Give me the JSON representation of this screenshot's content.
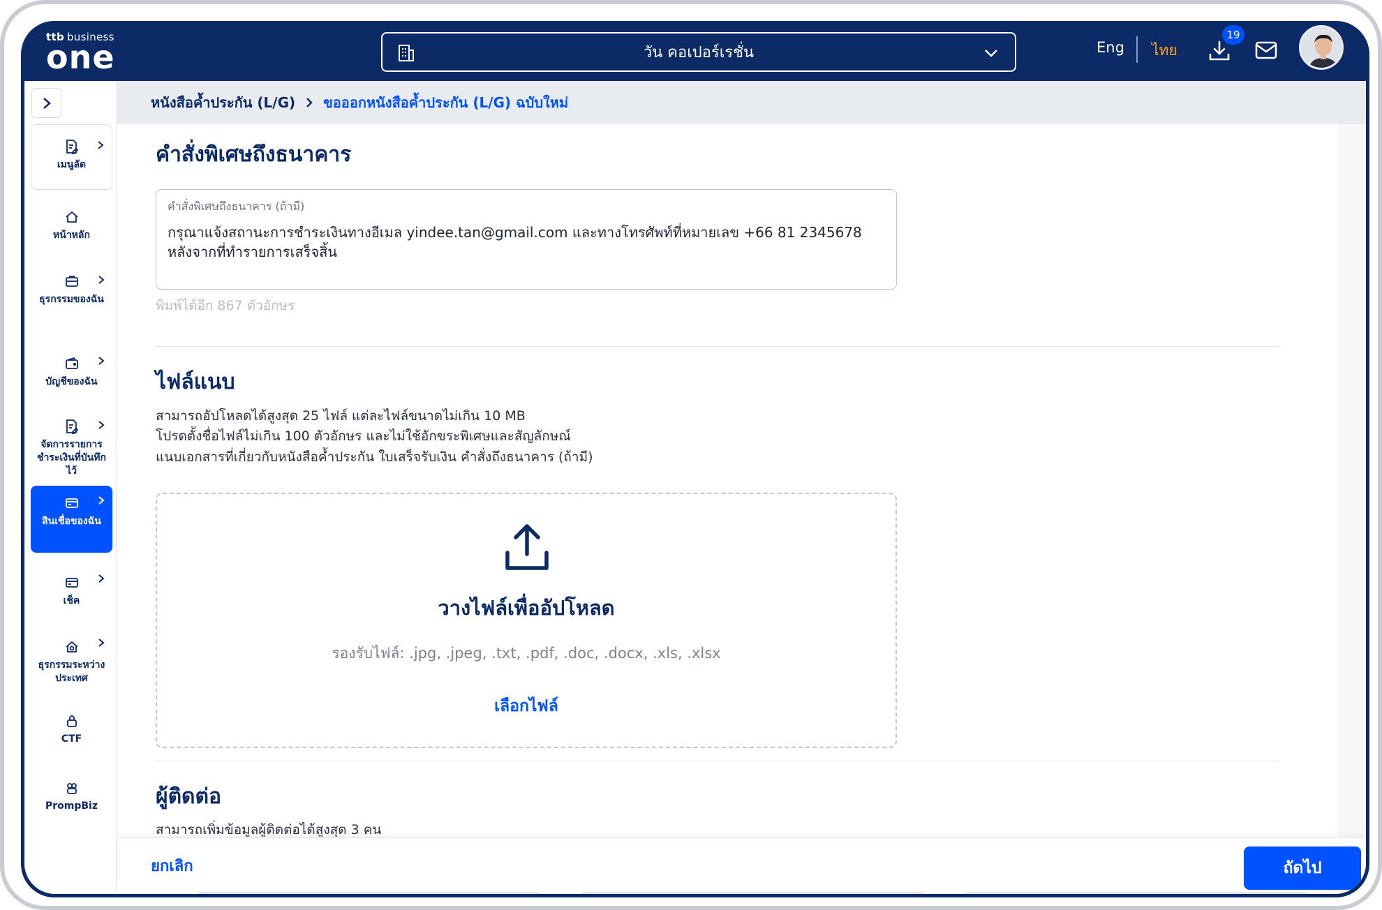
{
  "header": {
    "brand_small_a": "ttb",
    "brand_small_b": "business",
    "brand_big": "one",
    "company": "วัน คอเปอร์เรชั่น",
    "lang_eng": "Eng",
    "lang_thai": "ไทย",
    "download_badge": "19"
  },
  "sidebar": {
    "items": [
      {
        "label": "เมนูลัด"
      },
      {
        "label": "หน้าหลัก"
      },
      {
        "label": "ธุรกรรมของฉัน"
      },
      {
        "label": "บัญชีของฉัน"
      },
      {
        "label": "จัดการรายการชำระเงินที่บันทึกไว้"
      },
      {
        "label": "สินเชื่อของฉัน"
      },
      {
        "label": "เช็ค"
      },
      {
        "label": "ธุรกรรมระหว่างประเทศ"
      },
      {
        "label": "CTF"
      },
      {
        "label": "PrompBiz"
      }
    ]
  },
  "breadcrumb": {
    "level1": "หนังสือค้ำประกัน (L/G)",
    "level2": "ขอออกหนังสือค้ำประกัน (L/G) ฉบับใหม่"
  },
  "instructions": {
    "title": "คำสั่งพิเศษถึงธนาคาร",
    "field_label": "คำสั่งพิเศษถึงธนาคาร (ถ้ามี)",
    "field_value": "กรุณาแจ้งสถานะการชำระเงินทางอีเมล yindee.tan@gmail.com และทางโทรศัพท์ที่หมายเลข +66 81 2345678 หลังจากที่ทำรายการเสร็จสิ้น",
    "counter": "พิมพ์ได้อีก 867 ตัวอักษร"
  },
  "attachments": {
    "title": "ไฟล์แนบ",
    "desc1": "สามารถอัปโหลดได้สูงสุด 25 ไฟล์ แต่ละไฟล์ขนาดไม่เกิน 10 MB",
    "desc2": "โปรดตั้งชื่อไฟล์ไม่เกิน 100 ตัวอักษร และไม่ใช้อักขระพิเศษและสัญลักษณ์",
    "desc3": "แนบเอกสารที่เกี่ยวกับหนังสือค้ำประกัน ใบเสร็จรับเงิน คำสั่งถึงธนาคาร (ถ้ามี)",
    "drop_title": "วางไฟล์เพื่ออัปโหลด",
    "formats": "รองรับไฟล์: .jpg, .jpeg, .txt, .pdf, .doc, .docx, .xls, .xlsx",
    "choose": "เลือกไฟล์"
  },
  "contacts": {
    "title": "ผู้ติดต่อ",
    "desc": "สามารถเพิ่มข้อมูลผู้ติดต่อได้สูงสุด 3 คน"
  },
  "actions": {
    "cancel": "ยกเลิก",
    "next": "ถัดไป"
  },
  "colors": {
    "navy": "#0b2a66",
    "primary": "#0052ff",
    "accent_orange": "#f5a623"
  }
}
